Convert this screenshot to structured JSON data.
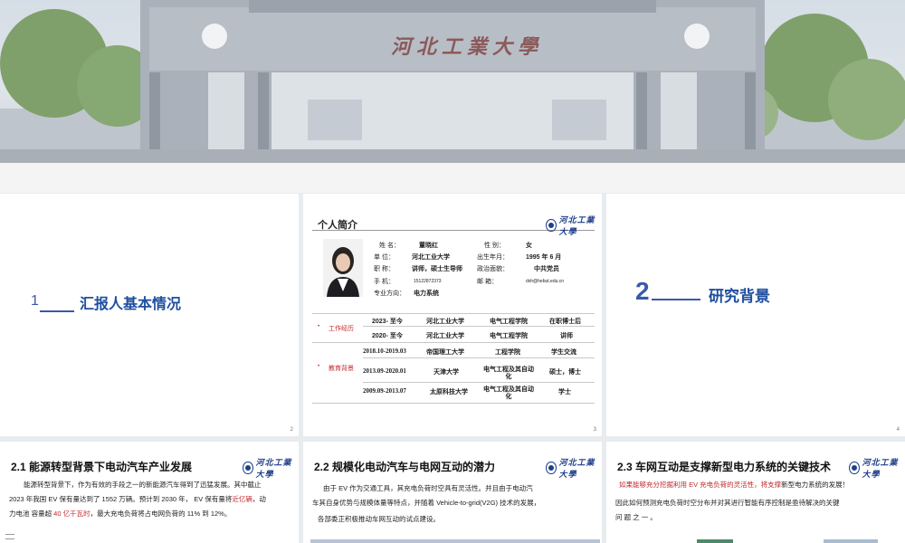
{
  "hero": {
    "university_name": "河北工業大學"
  },
  "slide_intro_section": {
    "number": "1",
    "title": "汇报人基本情况",
    "page": "2"
  },
  "profile": {
    "heading": "个人简介",
    "page": "3",
    "labels": {
      "name": "姓 名：",
      "gender": "性  别：",
      "unit": "单 位：",
      "birth": "出生年月：",
      "title": "职  称：",
      "politics": "政治面貌：",
      "phone": "手  机：",
      "email": "邮  箱：",
      "direction": "专业方向："
    },
    "values": {
      "name": "董晓红",
      "gender": "女",
      "unit": "河北工业大学",
      "birth": "1995 年 6 月",
      "title": "讲师，硕士生导师",
      "politics": "中共党员",
      "phone": "15122872373",
      "email": "dxh@hebut.edu.cn",
      "direction": "电力系统"
    },
    "work_label": "工作经历",
    "work_rows": [
      {
        "period": "2023- 至今",
        "org": "河北工业大学",
        "dept": "电气工程学院",
        "role": "在职博士后"
      },
      {
        "period": "2020- 至今",
        "org": "河北工业大学",
        "dept": "电气工程学院",
        "role": "讲师"
      }
    ],
    "edu_label": "教育背景",
    "edu_rows": [
      {
        "period": "2018.10-2019.03",
        "org": "帝国理工大学",
        "dept": "工程学院",
        "role": "学生交流"
      },
      {
        "period": "2013.09-2020.01",
        "org": "天津大学",
        "dept": "电气工程及其自动化",
        "role": "硕士，博士"
      },
      {
        "period": "2009.09-2013.07",
        "org": "太原科技大学",
        "dept": "电气工程及其自动化",
        "role": "学士"
      }
    ]
  },
  "slide_background_section": {
    "number": "2",
    "title": "研究背景",
    "page": "4"
  },
  "bottom1": {
    "title": "2.1 能源转型背景下电动汽车产业发展",
    "text1": "能源转型背景下，作为有效的手段之一的新能源汽车得到了迅猛发展。其中截止",
    "text2a": "2023 年我国 EV  保有量达到了 1552 万辆。预计到 2030 年，   EV  保有量将",
    "text2b": "近亿辆",
    "text2c": "，动",
    "text3a": "力电池  容量超 ",
    "text3b": "40 亿千瓦时",
    "text3c": "，最大充电负荷将占电网负荷的 11% 到 12%。"
  },
  "bottom2": {
    "title": "2.2 规模化电动汽车与电网互动的潜力",
    "text1": "由于 EV  作为交通工具，其充电负荷时空具有灵活性。并且由于电动汽",
    "text2": "车其自身优势与规模体量等特点，并随着 Vehicle-to-grid(V2G) 技术的发展，",
    "text3": "各部委正积极推动车网互动的试点建设。"
  },
  "bottom3": {
    "title": "2.3 车网互动是支撑新型电力系统的关键技术",
    "text1a": "如果能够充分挖掘利用 EV  充电负荷的灵活性，将支撑",
    "text1b": "新型电力系统的发展！",
    "text2": "因此如何预测充电负荷时空分布并对其进行智能有序控制是亟待解决的关键",
    "text3": "问 题 之 一 。"
  },
  "logo_text": "河北工業大學",
  "colors": {
    "accent": "#1f4fa0",
    "emphasis": "#c0282d"
  }
}
